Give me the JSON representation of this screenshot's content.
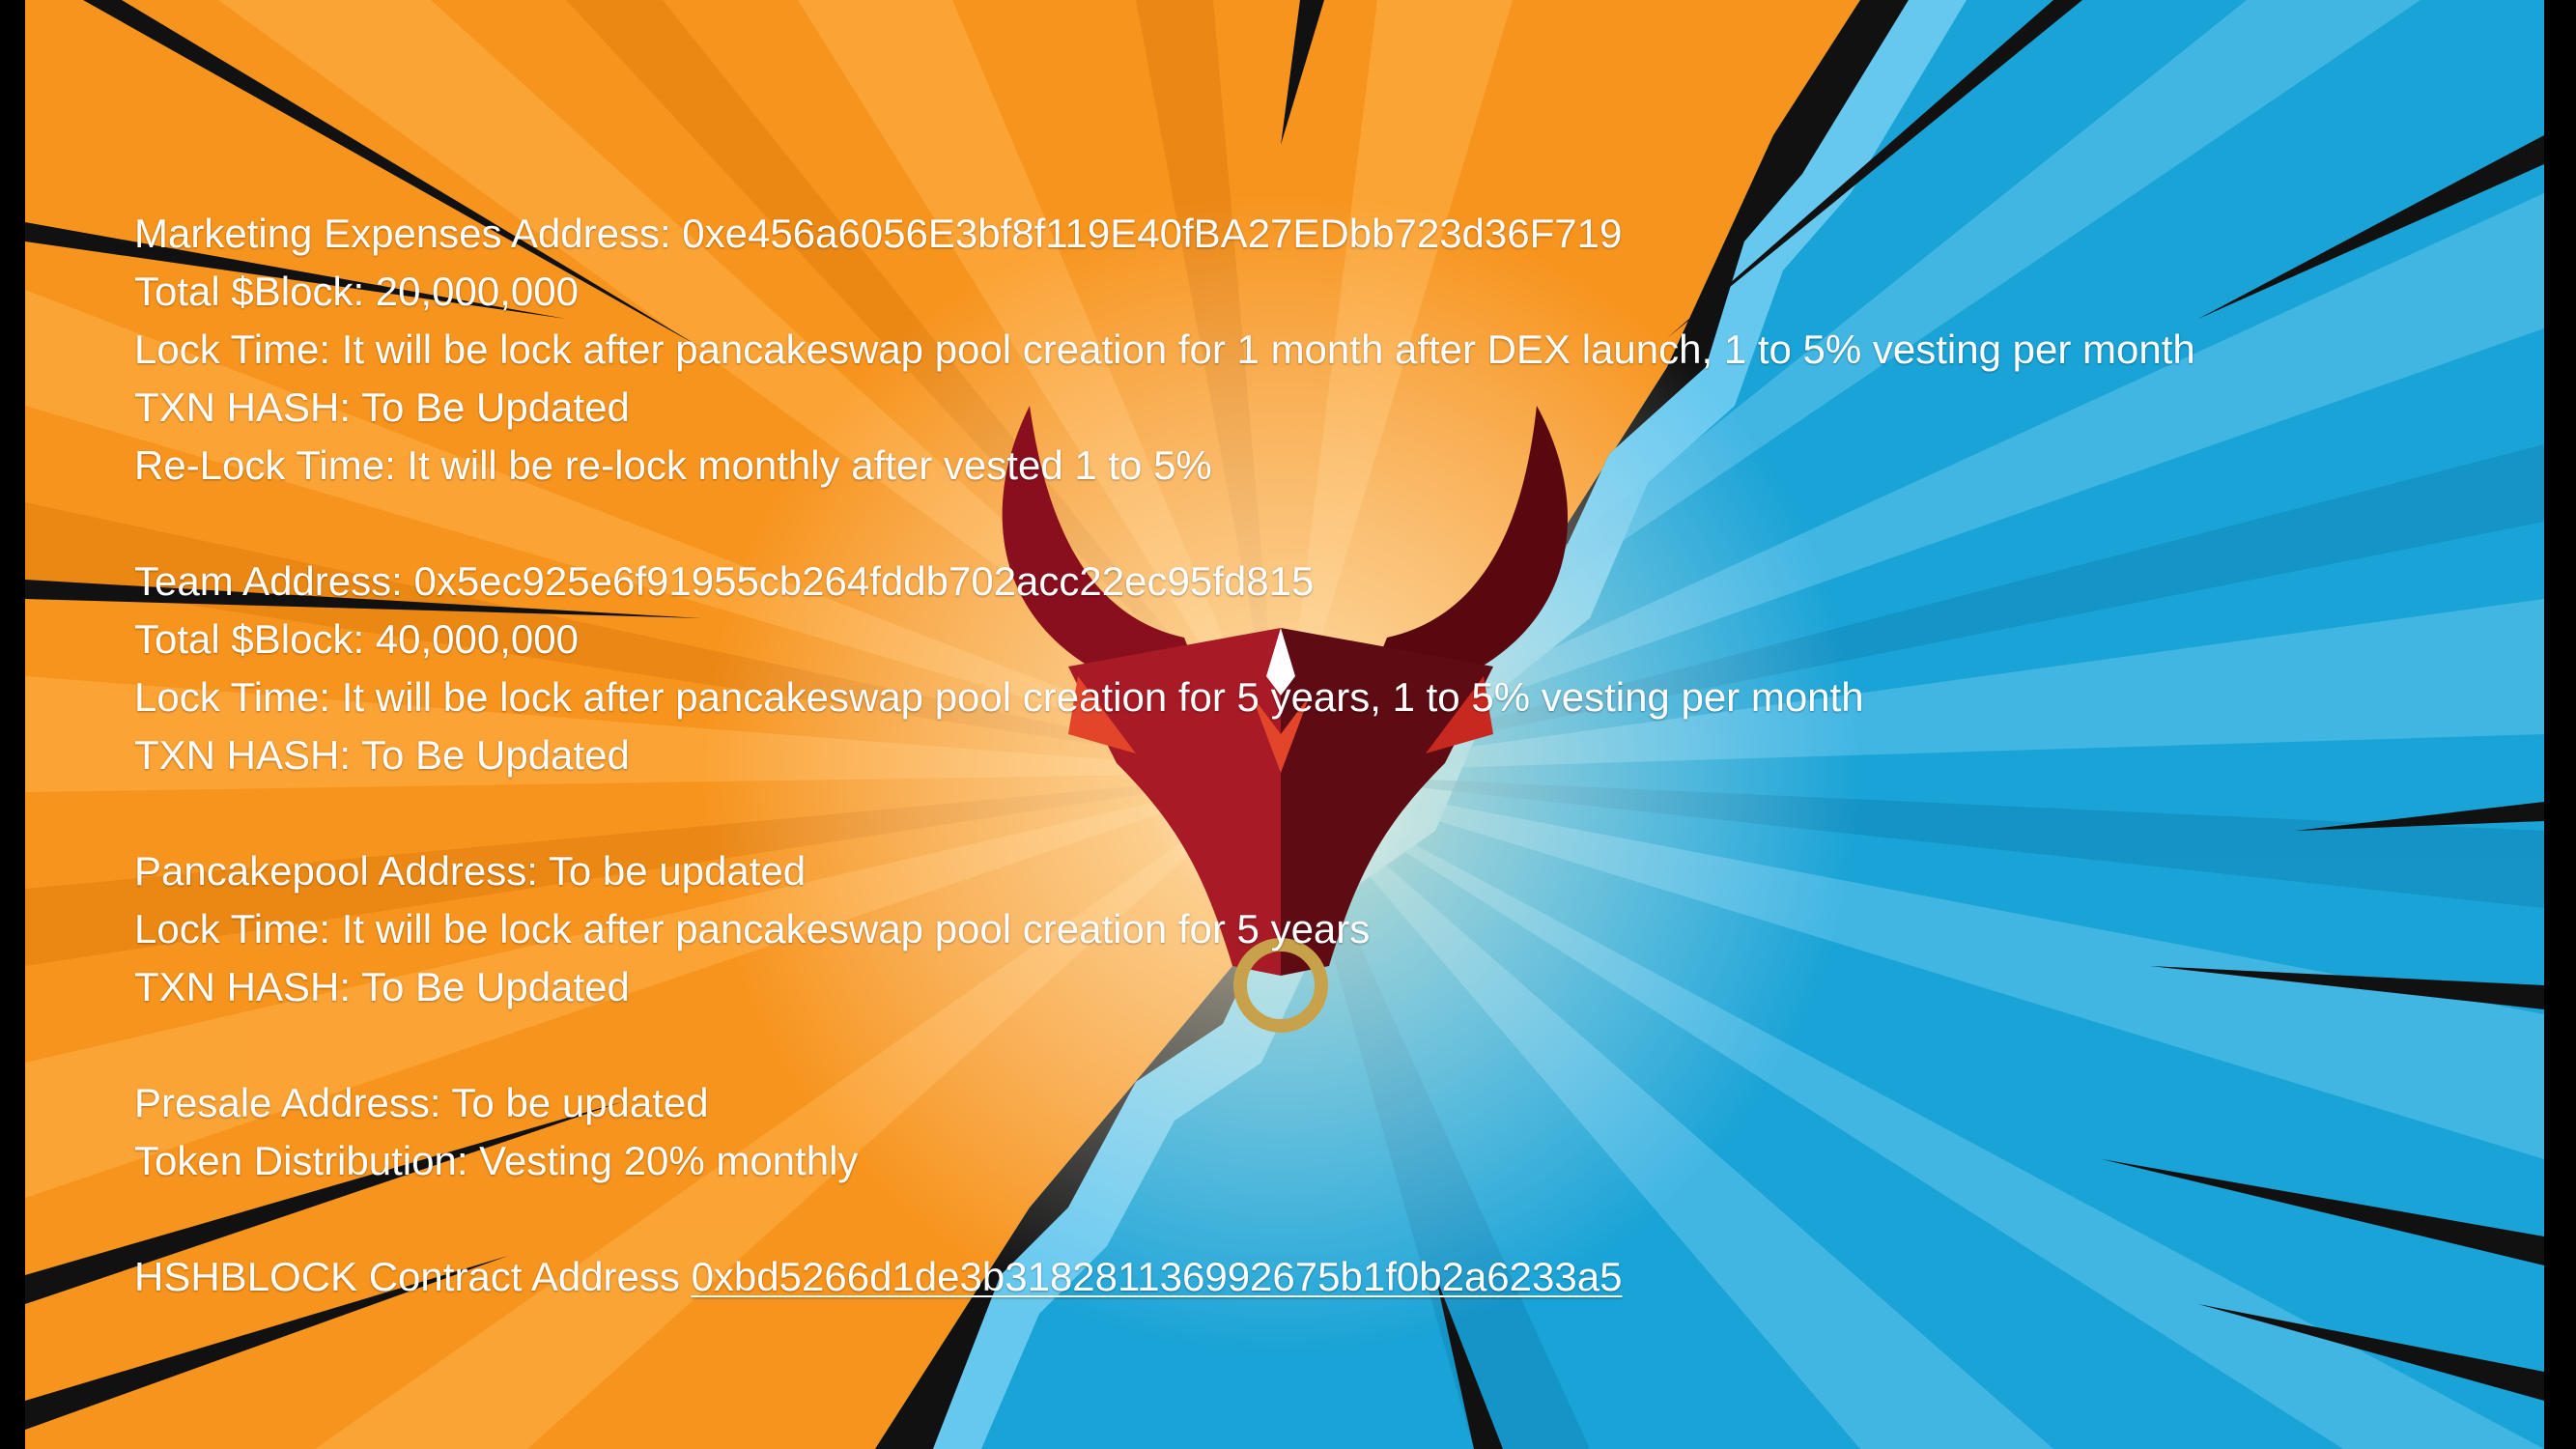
{
  "colors": {
    "orange": "#f7941d",
    "blue": "#1aa3d6",
    "text": "#ffffff",
    "bull_red": "#9e1b24",
    "bull_ring": "#c8a24a"
  },
  "marketing": {
    "address_label": "Marketing Expenses Address: ",
    "address": "0xe456a6056E3bf8f119E40fBA27EDbb723d36F719",
    "total": "Total $Block: 20,000,000",
    "lock_time": "Lock Time: It will be lock after pancakeswap pool creation for 1 month after DEX launch, 1 to 5% vesting per month",
    "txn_hash": "TXN HASH: To Be Updated",
    "relock_time": "Re-Lock Time: It will be re-lock monthly after vested 1 to 5%"
  },
  "team": {
    "address_label": "Team Address: ",
    "address": "0x5ec925e6f91955cb264fddb702acc22ec95fd815",
    "total": "Total $Block: 40,000,000",
    "lock_time": "Lock Time: It will be lock after pancakeswap pool creation for 5 years, 1 to 5% vesting per month",
    "txn_hash": "TXN HASH: To Be Updated"
  },
  "pancakepool": {
    "address": "Pancakepool Address: To be updated",
    "lock_time": "Lock Time: It will be lock after pancakeswap pool creation for 5 years",
    "txn_hash": "TXN HASH: To Be Updated"
  },
  "presale": {
    "address": "Presale Address: To be updated",
    "distribution": "Token Distribution: Vesting 20% monthly"
  },
  "contract": {
    "label": "HSHBLOCK Contract Address ",
    "address": "0xbd5266d1de3b318281136992675b1f0b2a6233a5"
  }
}
